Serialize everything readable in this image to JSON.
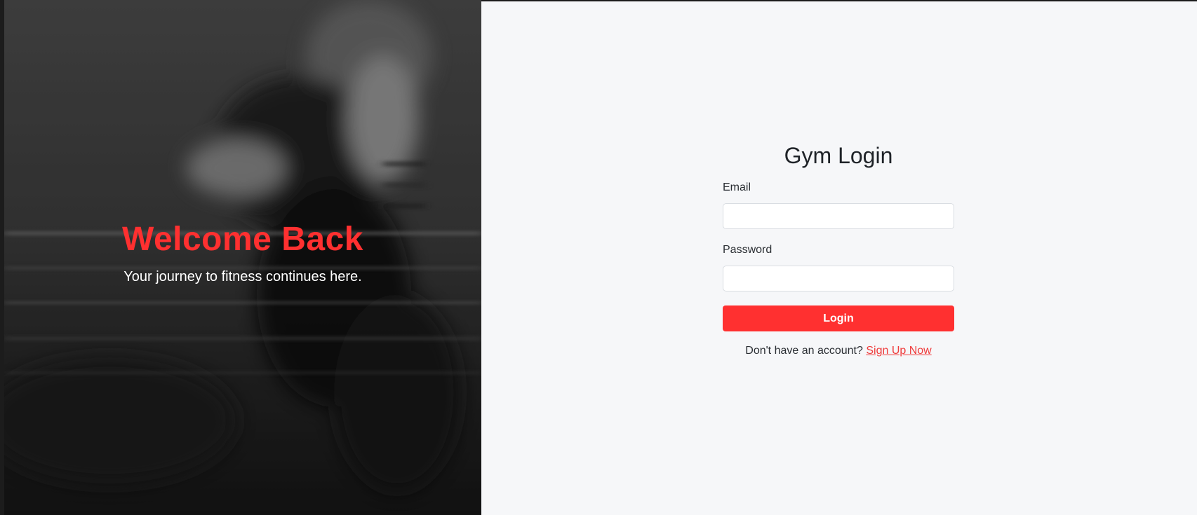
{
  "hero": {
    "title": "Welcome Back",
    "subtitle": "Your journey to fitness continues here."
  },
  "login": {
    "title": "Gym Login",
    "email_label": "Email",
    "email_value": "",
    "password_label": "Password",
    "password_value": "",
    "button_label": "Login",
    "signup_prompt": "Don't have an account?",
    "signup_link": "Sign Up Now"
  },
  "colors": {
    "accent": "#ff3030",
    "panel_bg": "#f6f7f9",
    "hero_overlay": "#2a2a2a"
  }
}
